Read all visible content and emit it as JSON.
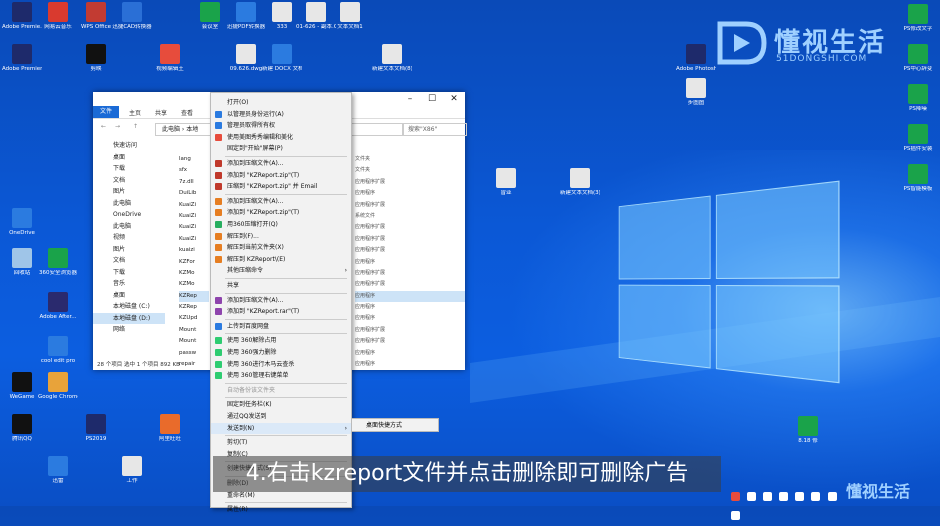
{
  "desktop_icons": [
    {
      "label": "Adobe Premie...",
      "color": "#1e2a6b"
    },
    {
      "label": "网易云音乐",
      "color": "#d93a2f"
    },
    {
      "label": "WPS Office",
      "color": "#c23b32"
    },
    {
      "label": "迅捷CAD转换器",
      "color": "#2a6fd6"
    },
    {
      "label": "会议室",
      "color": "#1aa34a"
    },
    {
      "label": "迅捷PDF转换器",
      "color": "#2b7be0"
    },
    {
      "label": "333",
      "color": "#e7e7e7"
    },
    {
      "label": "01-626 - 副本.CAD",
      "color": "#e7e7e7"
    },
    {
      "label": "文本文档1",
      "color": "#e7e7e7"
    },
    {
      "label": "PS修改文字",
      "color": "#1aa34a"
    },
    {
      "label": "Adobe Photosh...",
      "color": "#1e2a6b"
    },
    {
      "label": "PS中心辞变",
      "color": "#1aa34a"
    },
    {
      "label": "步图图",
      "color": "#e7e7e7"
    },
    {
      "label": "PS降噪",
      "color": "#1aa34a"
    },
    {
      "label": "PS插件安装",
      "color": "#1aa34a"
    },
    {
      "label": "PS智能模板",
      "color": "#1aa34a"
    },
    {
      "label": "曾亚",
      "color": "#e7e7e7"
    },
    {
      "label": "新建文本文档(3)",
      "color": "#e7e7e7"
    },
    {
      "label": "8.18 修",
      "color": "#1aa34a"
    },
    {
      "label": "Adobe Premiere...",
      "color": "#1e2a6b"
    },
    {
      "label": "剪映",
      "color": "#111111"
    },
    {
      "label": "视频编辑王",
      "color": "#e74c3c"
    },
    {
      "label": "09.626.dwg",
      "color": "#e7e7e7"
    },
    {
      "label": "新建 DOCX 文档",
      "color": "#2b7be0"
    },
    {
      "label": "新建文本文档(8)",
      "color": "#e7e7e7"
    },
    {
      "label": "回收站",
      "color": "#9fc5e8"
    },
    {
      "label": "360安全浏览器",
      "color": "#1aa34a"
    },
    {
      "label": "OneDrive",
      "color": "#2b7be0"
    },
    {
      "label": "Adobe After...",
      "color": "#2a2a6e"
    },
    {
      "label": "cool edit pro",
      "color": "#2b7be0"
    },
    {
      "label": "WeGame",
      "color": "#111111"
    },
    {
      "label": "Google Chrome",
      "color": "#e8a33a"
    },
    {
      "label": "腾讯QQ",
      "color": "#111111"
    },
    {
      "label": "PS2019",
      "color": "#1e2a6b"
    },
    {
      "label": "阿里旺旺",
      "color": "#e96b2b"
    },
    {
      "label": "迅雷",
      "color": "#2b7be0"
    },
    {
      "label": "工作",
      "color": "#e7e7e7"
    }
  ],
  "explorer": {
    "ribbon_tabs": [
      "文件",
      "主页",
      "共享",
      "查看"
    ],
    "address": "此电脑 › 本地",
    "search_placeholder": "搜索\"X86\"",
    "nav_items": [
      "快速访问",
      "桌面",
      "下载",
      "文档",
      "图片",
      "此电脑",
      "OneDrive",
      "此电脑",
      "视频",
      "图片",
      "文档",
      "下载",
      "音乐",
      "桌面",
      "本地磁盘 (C:)",
      "本地磁盘 (D:)",
      "网络"
    ],
    "files": [
      "lang",
      "sfx",
      "7z.dll",
      "DuiLib",
      "KuaiZi",
      "KuaiZi",
      "KuaiZi",
      "KuaiZi",
      "kuaizi",
      "KZFor",
      "KZMo",
      "KZMo",
      "KZRep",
      "KZRep",
      "KZUpd",
      "Mount",
      "Mount",
      "passw",
      "repair"
    ],
    "types": [
      "文件夹",
      "文件夹",
      "应用程序扩展",
      "应用程序",
      "应用程序扩展",
      "系统文件",
      "应用程序扩展",
      "应用程序扩展",
      "应用程序扩展",
      "应用程序",
      "应用程序扩展",
      "应用程序扩展",
      "应用程序",
      "应用程序",
      "应用程序",
      "应用程序扩展",
      "应用程序扩展",
      "应用程序",
      "应用程序"
    ],
    "status": "28 个项目   选中 1 个项目  892 KB"
  },
  "context_menu": {
    "items": [
      "打开(O)",
      "以管理员身份运行(A)",
      "管理员取得所有权",
      "使用美图秀秀编辑和美化",
      "固定到\"开始\"屏幕(P)",
      "添加到压缩文件(A)...",
      "添加到 \"KZReport.zip\"(T)",
      "压缩到 \"KZReport.zip\" 并 Email",
      "添加到压缩文件(A)...",
      "添加到 \"KZReport.zip\"(T)",
      "用360压缩打开(Q)",
      "解压到(F)...",
      "解压到当前文件夹(X)",
      "解压到 KZReport\\(E)",
      "其他压缩命令",
      "共享",
      "添加到压缩文件(A)...",
      "添加到 \"KZReport.rar\"(T)",
      "上传到百度网盘",
      "使用 360解除占用",
      "使用 360强力删除",
      "使用 360进行木马云查杀",
      "使用 360管理右键菜单",
      "自动备份该文件夹",
      "固定到任务栏(K)",
      "通过QQ发送到",
      "发送到(N)",
      "剪切(T)",
      "复制(C)",
      "创建快捷方式(S)",
      "删除(D)",
      "重命名(M)",
      "属性(R)"
    ],
    "submenu_item": "桌面快捷方式"
  },
  "caption": "4.右击kzreport文件并点击删除即可删除广告",
  "watermark": {
    "brand": "懂视生活",
    "domain": "51DONGSHI.COM"
  },
  "colors": {
    "accent": "#1a6ad6",
    "menu_bg": "#f2f2f2",
    "selection": "#cde3f7"
  }
}
